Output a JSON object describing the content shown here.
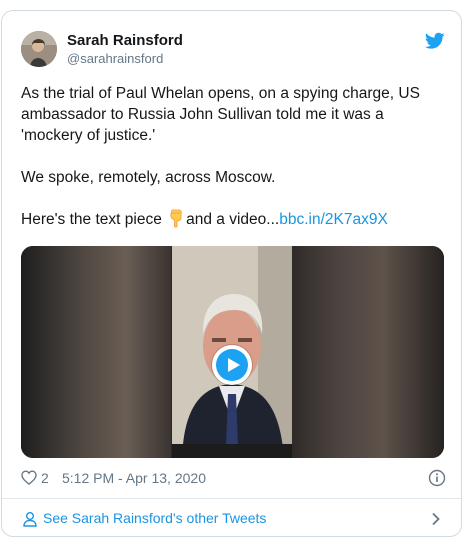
{
  "tweet": {
    "author": {
      "display_name": "Sarah Rainsford",
      "handle": "@sarahrainsford",
      "avatar_icon": "avatar"
    },
    "brand_icon": "twitter-bird-icon",
    "text": {
      "paragraph_1": "As the trial of Paul Whelan opens, on a spying charge, US ambassador to Russia John Sullivan told me it was a 'mockery of justice.'",
      "paragraph_2": "We spoke, remotely, across Moscow.",
      "paragraph_3_before": "Here's the text piece ",
      "paragraph_3_emoji": "backhand-index-pointing-down-icon",
      "paragraph_3_after": "and a video...",
      "link": "bbc.in/2K7ax9X"
    },
    "media": {
      "type": "video",
      "play_icon": "play-icon"
    },
    "likes": "2",
    "timestamp": "5:12 PM - Apr 13, 2020",
    "info_icon": "info-icon"
  },
  "footer": {
    "label": "See Sarah Rainsford's other Tweets",
    "icon": "person-icon",
    "chevron": "chevron-right-icon"
  },
  "colors": {
    "link": "#1b95e0",
    "brand": "#1da1f2",
    "text": "#14171a",
    "muted": "#657786",
    "border": "#d3dbe2"
  }
}
